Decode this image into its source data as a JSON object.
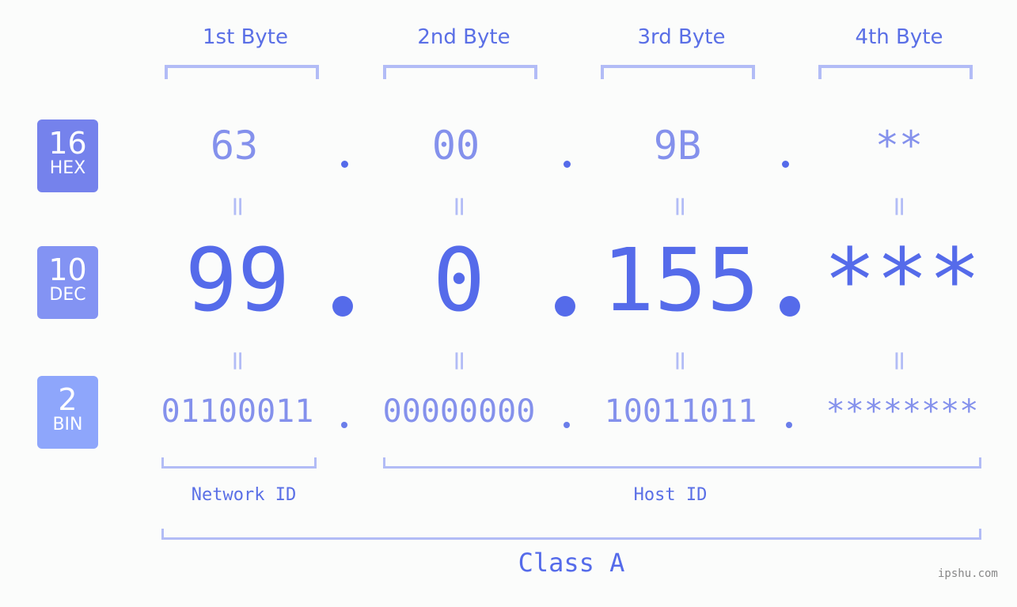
{
  "bytes": [
    {
      "label": "1st Byte",
      "hex": "63",
      "dec": "99",
      "bin": "01100011"
    },
    {
      "label": "2nd Byte",
      "hex": "00",
      "dec": "0",
      "bin": "00000000"
    },
    {
      "label": "3rd Byte",
      "hex": "9B",
      "dec": "155",
      "bin": "10011011"
    },
    {
      "label": "4th Byte",
      "hex": "**",
      "dec": "***",
      "bin": "********"
    }
  ],
  "badges": {
    "hex": {
      "num": "16",
      "label": "HEX",
      "color": "#7582ec"
    },
    "dec": {
      "num": "10",
      "label": "DEC",
      "color": "#8393f3"
    },
    "bin": {
      "num": "2",
      "label": "BIN",
      "color": "#8ea6fb"
    }
  },
  "equals_sign": "=",
  "network_label": "Network ID",
  "host_label": "Host ID",
  "class_label": "Class A",
  "watermark": "ipshu.com",
  "colors": {
    "accent": "#556bea",
    "light": "#8491ec",
    "bracket": "#b2bcf6"
  }
}
